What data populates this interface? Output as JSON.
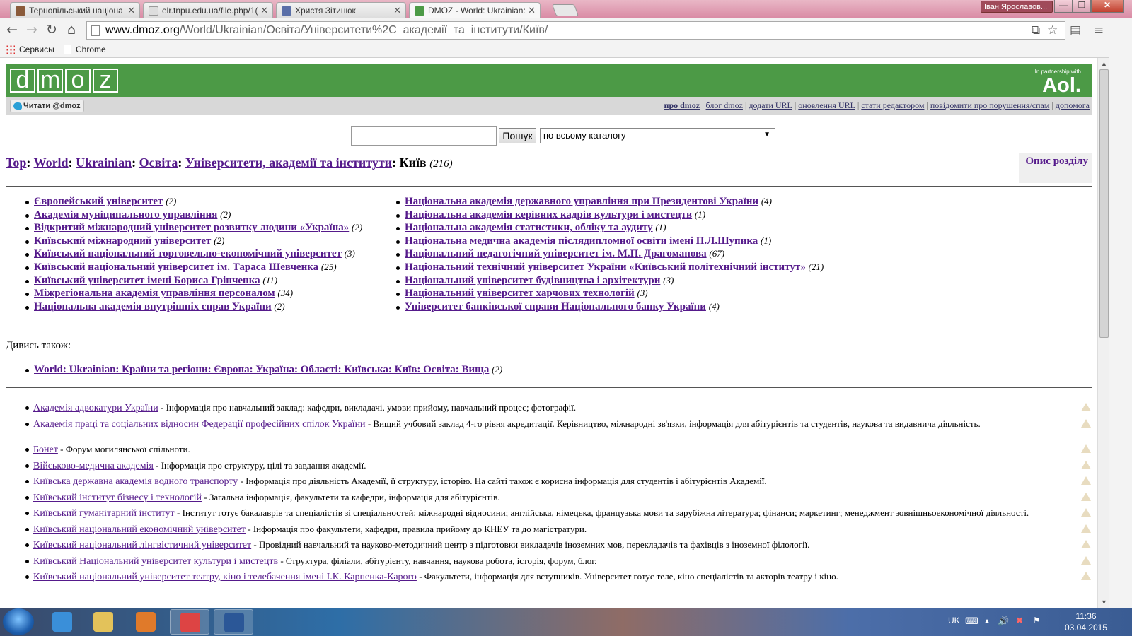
{
  "browser": {
    "tabs": [
      {
        "title": "Тернопільський націона",
        "color": "#8a5a3a"
      },
      {
        "title": "elr.tnpu.edu.ua/file.php/1(",
        "color": "#bbbbbb"
      },
      {
        "title": "Христя Зітинюк",
        "color": "#5a6fa8"
      },
      {
        "title": "DMOZ - World: Ukrainian:",
        "color": "#4c9a46"
      }
    ],
    "tab_close": "✕",
    "user": "Іван Ярославов...",
    "window_buttons": {
      "minimize": "—",
      "restore": "❐",
      "close": "✕"
    },
    "nav": {
      "back": "←",
      "forward": "→",
      "reload": "↻",
      "home": "⌂"
    },
    "url": {
      "host": "www.dmoz.org",
      "path": "/World/Ukrainian/Освіта/Університети%2C_академії_та_інститути/Київ/"
    },
    "omni_icons": {
      "translate": "⧉",
      "star": "☆",
      "extension": "▤",
      "menu": "≡"
    },
    "bookmarks": [
      "Сервисы",
      "Chrome"
    ]
  },
  "site": {
    "logo_letters": [
      "d",
      "m",
      "o",
      "z"
    ],
    "partner_small": "In partnership with",
    "partner": "Aol.",
    "twitter": "Читати @dmoz",
    "toplinks": [
      "про dmoz",
      "блог dmoz",
      "додати URL",
      "оновлення URL",
      "стати редактором",
      "повідомити про порушення/спам",
      "допомога"
    ],
    "search_button": "Пошук",
    "search_scope": "по всьому каталогу",
    "search_value": ""
  },
  "breadcrumb": {
    "items": [
      "Top",
      "World",
      "Ukrainian",
      "Освіта",
      "Університети, академії та інститути"
    ],
    "current": "Київ",
    "count": "(216)",
    "sep": ":"
  },
  "description_link": "Опис розділу",
  "categories_left": [
    {
      "name": "Європейський університет",
      "count": "(2)"
    },
    {
      "name": "Академія муніципального управління",
      "count": "(2)"
    },
    {
      "name": "Відкритий міжнародний університет розвитку людини «Україна»",
      "count": "(2)"
    },
    {
      "name": "Київський міжнародний університет",
      "count": "(2)"
    },
    {
      "name": "Київський національний торговельно-економічний університет",
      "count": "(3)"
    },
    {
      "name": "Київський національний університет ім. Тараса Шевченка",
      "count": "(25)"
    },
    {
      "name": "Київський університет імені Бориса Грінченка",
      "count": "(11)"
    },
    {
      "name": "Міжрегіональна академія управління персоналом",
      "count": "(34)"
    },
    {
      "name": "Національна академія внутрішніх справ України",
      "count": "(2)"
    }
  ],
  "categories_right": [
    {
      "name": "Національна академія державного управління при Президентові України",
      "count": "(4)"
    },
    {
      "name": "Національна академія керівних кадрів культури і мистецтв",
      "count": "(1)"
    },
    {
      "name": "Національна академія статистики, обліку та аудиту",
      "count": "(1)"
    },
    {
      "name": "Національна медична академія післядипломної освіти імені П.Л.Шупика",
      "count": "(1)"
    },
    {
      "name": "Національний педагогічний університет ім. М.П. Драгоманова",
      "count": "(67)"
    },
    {
      "name": "Національний технічний університет України «Київський політехнічний інститут»",
      "count": "(21)"
    },
    {
      "name": "Національний університет будівництва і архітектури",
      "count": "(3)"
    },
    {
      "name": "Національний університет харчових технологій",
      "count": "(3)"
    },
    {
      "name": "Університет банківської справи Національного банку України",
      "count": "(4)"
    }
  ],
  "see_also": {
    "label": "Дивись також:",
    "link": "World: Ukrainian: Країни та регіони: Європа: Україна: Області: Київська: Київ: Освіта: Вища",
    "count": "(2)"
  },
  "sites": [
    {
      "name": "Академія адвокатури України",
      "desc": " - Інформація про навчальний заклад: кафедри, викладачі, умови прийому, навчальний процес; фотографії."
    },
    {
      "name": "Академія праці та соціальних відносин Федерації професійних спілок України",
      "desc": " - Вищий учбовий заклад 4-го рівня акредитації. Керівництво, міжнародні зв'язки, інформація для абітурієнтів та студентів, наукова та видавнича діяльність."
    },
    {
      "name": "Бонет",
      "desc": " - Форум могилянської спільноти."
    },
    {
      "name": "Військово-медична академія",
      "desc": " - Інформація про структуру, цілі та завдання академії."
    },
    {
      "name": "Київська державна академія водного транспорту",
      "desc": " - Інформація про діяльність Академії, її структуру, історію. На сайті також є корисна інформація для студентів і абітурієнтів Академії."
    },
    {
      "name": "Київський інститут бізнесу і технологій",
      "desc": " - Загальна інформація, факультети та кафедри, інформація для абітурієнтів."
    },
    {
      "name": "Київський гуманітарний інститут",
      "desc": " - Інститут готує бакалаврів та спеціалістів зі спеціальностей: міжнародні відносини; англійська, німецька, французька мови та зарубіжна література; фінанси; маркетинг; менеджмент зовнішньоекономічної діяльності."
    },
    {
      "name": "Київський національний економічний університет",
      "desc": " - Інформація про факультети, кафедри, правила прийому до КНЕУ та до магістратури."
    },
    {
      "name": "Київський національний лінгвістичний університет",
      "desc": " - Провідний навчальний та науково-методичний центр з підготовки викладачів іноземних мов, перекладачів та фахівців з іноземної філології."
    },
    {
      "name": "Київський Національний університет культури і мистецтв",
      "desc": " - Структура, філіали, абітурієнту, навчання, наукова робота, історія, форум, блог."
    },
    {
      "name": "Київський національний університет театру, кіно і телебачення імені І.К. Карпенка-Карого",
      "desc": " - Факультети, інформація для вступників. Університет готує теле, кіно спеціалістів та акторів театру і кіно."
    }
  ],
  "taskbar": {
    "apps": [
      {
        "icon": "internet-explorer-icon",
        "color": "#3a8fd9"
      },
      {
        "icon": "file-explorer-icon",
        "color": "#e3c25a"
      },
      {
        "icon": "media-player-icon",
        "color": "#e07a2a"
      },
      {
        "icon": "chrome-icon",
        "color": "#d44"
      },
      {
        "icon": "word-icon",
        "color": "#2b5797"
      }
    ],
    "lang": "UK",
    "time": "11:36",
    "date": "03.04.2015"
  }
}
